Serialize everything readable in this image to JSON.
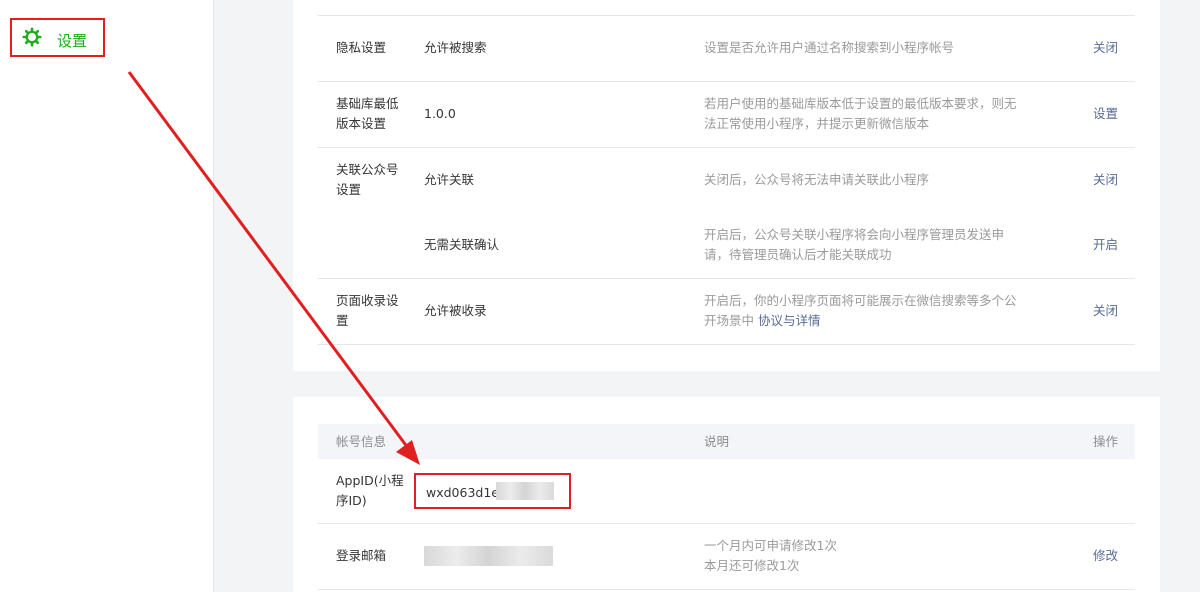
{
  "sidebar": {
    "settings_label": "设置",
    "icon": "gear-icon",
    "accent_color": "#1aad19"
  },
  "settings": {
    "rows": [
      {
        "label": "隐私设置",
        "value": "允许被搜索",
        "desc": "设置是否允许用户通过名称搜索到小程序帐号",
        "action": "关闭"
      },
      {
        "label_line1": "基础库最低",
        "label_line2": "版本设置",
        "value": "1.0.0",
        "desc_line1": "若用户使用的基础库版本低于设置的最低版本要求，则无",
        "desc_line2": "法正常使用小程序，并提示更新微信版本",
        "action": "设置"
      },
      {
        "label_line1": "关联公众号",
        "label_line2": "设置",
        "value": "允许关联",
        "desc": "关闭后，公众号将无法申请关联此小程序",
        "action": "关闭"
      },
      {
        "value": "无需关联确认",
        "desc_line1": "开启后，公众号关联小程序将会向小程序管理员发送申",
        "desc_line2": "请，待管理员确认后才能关联成功",
        "action": "开启"
      },
      {
        "label_line1": "页面收录设",
        "label_line2": "置",
        "value": "允许被收录",
        "desc_line1": "开启后，你的小程序页面将可能展示在微信搜索等多个公",
        "desc_line2_prefix": "开场景中 ",
        "desc_link": "协议与详情",
        "action": "关闭"
      }
    ]
  },
  "account": {
    "headers": {
      "col1": "帐号信息",
      "col2": "说明",
      "col3": "操作"
    },
    "appid": {
      "label_line1": "AppID(小程",
      "label_line2": "序ID)",
      "value": "wxd063d1ea"
    },
    "email": {
      "label": "登录邮箱",
      "desc_line1": "一个月内可申请修改1次",
      "desc_line2": "本月还可修改1次",
      "action": "修改"
    }
  },
  "annotation_color": "#e02020"
}
